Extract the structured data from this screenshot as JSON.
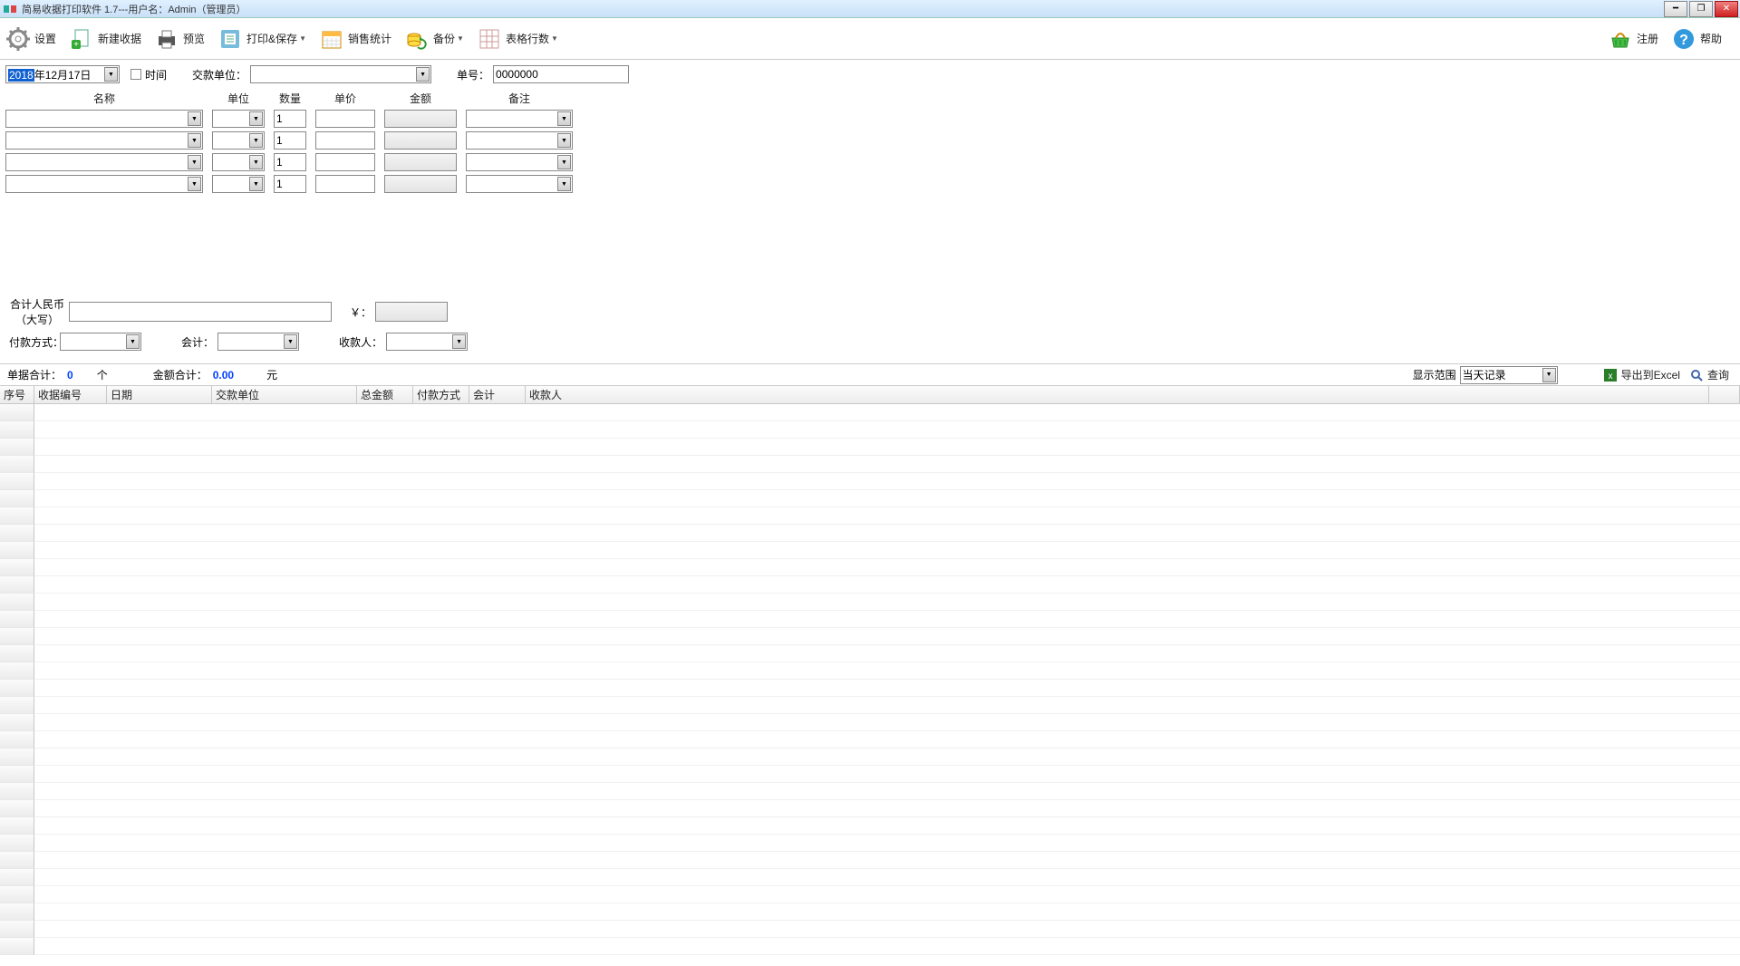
{
  "title": "简易收据打印软件 1.7---用户名：Admin（管理员）",
  "toolbar": {
    "settings": "设置",
    "new_receipt": "新建收据",
    "preview": "预览",
    "print_save": "打印&保存",
    "sales_stats": "销售统计",
    "backup": "备份",
    "table_rows": "表格行数",
    "register": "注册",
    "help": "帮助"
  },
  "form": {
    "date_year_sel": "2018",
    "date_rest": "年12月17日",
    "time_label": "时间",
    "payer_label": "交款单位：",
    "docno_label": "单号：",
    "docno_value": "0000000",
    "headers": {
      "name": "名称",
      "unit": "单位",
      "qty": "数量",
      "price": "单价",
      "amount": "金额",
      "remark": "备注"
    },
    "rows": [
      {
        "qty": "1"
      },
      {
        "qty": "1"
      },
      {
        "qty": "1"
      },
      {
        "qty": "1"
      }
    ],
    "total_rmb_label1": "合计人民币",
    "total_rmb_label2": "（大写）",
    "currency": "￥：",
    "pay_method": "付款方式：",
    "accountant": "会计：",
    "payee": "收款人："
  },
  "sumbar": {
    "doc_total_label": "单据合计：",
    "doc_total_value": "0",
    "doc_total_unit": "个",
    "amt_total_label": "金额合计：",
    "amt_total_value": "0.00",
    "amt_total_unit": "元",
    "range_label": "显示范围",
    "range_value": "当天记录",
    "export": "导出到Excel",
    "query": "查询"
  },
  "table": {
    "cols": [
      "序号",
      "收据编号",
      "日期",
      "交款单位",
      "总金额",
      "付款方式",
      "会计",
      "收款人"
    ]
  }
}
